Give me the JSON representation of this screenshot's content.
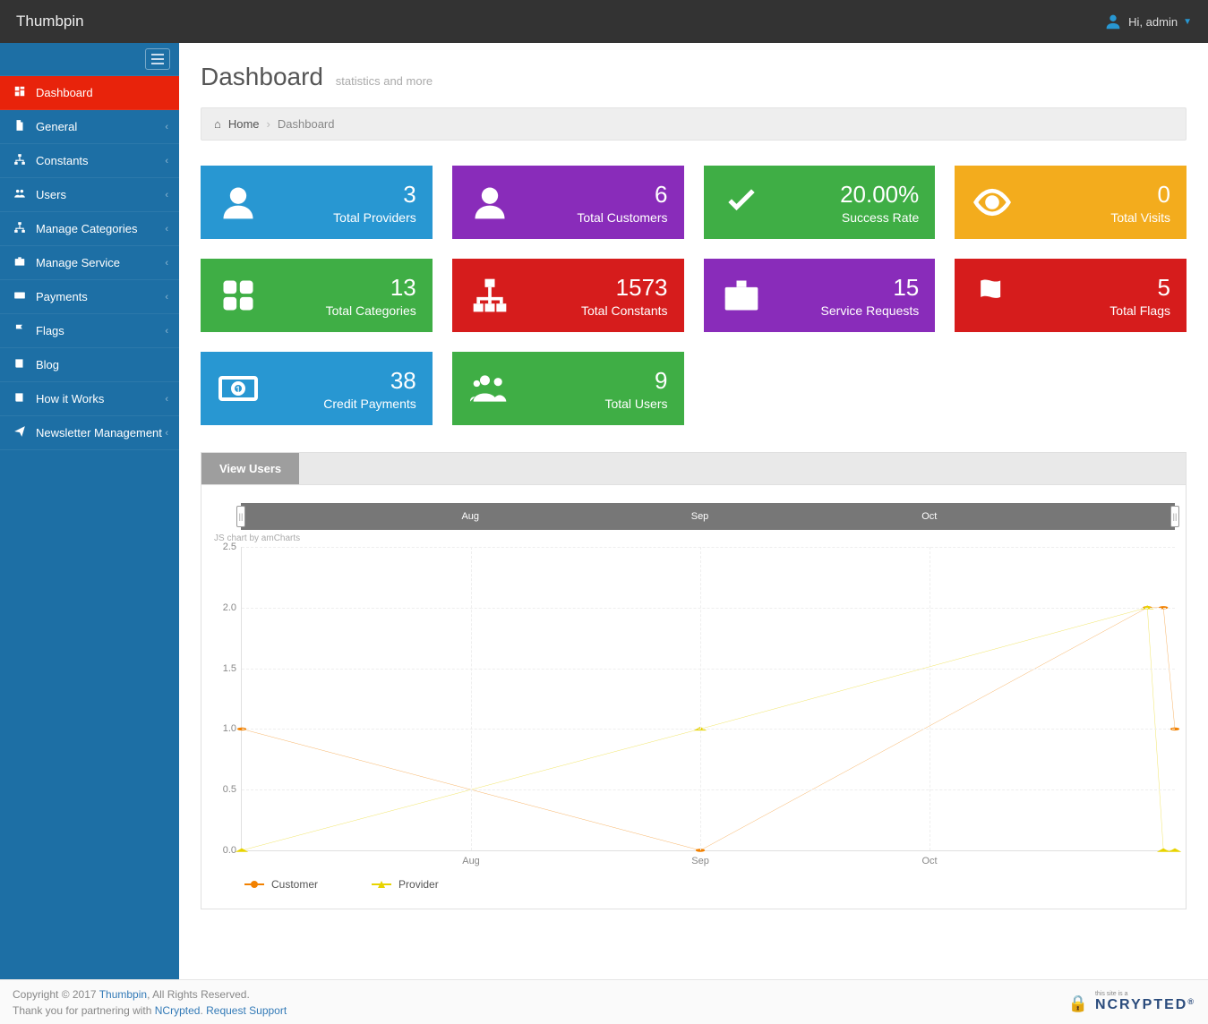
{
  "brand": "Thumbpin",
  "user_greeting": "Hi, admin",
  "page": {
    "title": "Dashboard",
    "subtitle": "statistics and more"
  },
  "breadcrumb": {
    "home": "Home",
    "current": "Dashboard"
  },
  "sidebar": [
    {
      "icon": "dashboard",
      "label": "Dashboard",
      "active": true,
      "expandable": false
    },
    {
      "icon": "file",
      "label": "General",
      "expandable": true
    },
    {
      "icon": "sitemap",
      "label": "Constants",
      "expandable": true
    },
    {
      "icon": "users",
      "label": "Users",
      "expandable": true
    },
    {
      "icon": "sitemap",
      "label": "Manage Categories",
      "expandable": true
    },
    {
      "icon": "briefcase",
      "label": "Manage Service",
      "expandable": true
    },
    {
      "icon": "money",
      "label": "Payments",
      "expandable": true
    },
    {
      "icon": "flag",
      "label": "Flags",
      "expandable": true
    },
    {
      "icon": "book",
      "label": "Blog",
      "expandable": false
    },
    {
      "icon": "book",
      "label": "How it Works",
      "expandable": true
    },
    {
      "icon": "send",
      "label": "Newsletter Management",
      "expandable": true
    }
  ],
  "cards": [
    {
      "icon": "user",
      "value": "3",
      "label": "Total Providers",
      "color": "blue"
    },
    {
      "icon": "user",
      "value": "6",
      "label": "Total Customers",
      "color": "purple"
    },
    {
      "icon": "check",
      "value": "20.00%",
      "label": "Success Rate",
      "color": "green"
    },
    {
      "icon": "eye",
      "value": "0",
      "label": "Total Visits",
      "color": "amber"
    },
    {
      "icon": "grid",
      "value": "13",
      "label": "Total Categories",
      "color": "green"
    },
    {
      "icon": "sitemap",
      "value": "1573",
      "label": "Total Constants",
      "color": "red"
    },
    {
      "icon": "briefcase",
      "value": "15",
      "label": "Service Requests",
      "color": "purple"
    },
    {
      "icon": "flag",
      "value": "5",
      "label": "Total Flags",
      "color": "red"
    },
    {
      "icon": "money",
      "value": "38",
      "label": "Credit Payments",
      "color": "blue"
    },
    {
      "icon": "users",
      "value": "9",
      "label": "Total Users",
      "color": "green"
    }
  ],
  "tabs": {
    "view_users": "View Users"
  },
  "chart_credit": "JS chart by amCharts",
  "chart_data": {
    "type": "line",
    "xlabels_slider": [
      "Aug",
      "Sep",
      "Oct"
    ],
    "xlabels": [
      "Aug",
      "Sep",
      "Oct"
    ],
    "ylim": [
      0.0,
      2.5
    ],
    "yticks": [
      0.0,
      0.5,
      1.0,
      1.5,
      2.0,
      2.5
    ],
    "x": [
      0,
      1,
      2,
      3,
      3.95,
      4.02,
      4.07
    ],
    "series": [
      {
        "name": "Customer",
        "color": "#f28100",
        "shape": "circle",
        "values": [
          1,
          null,
          0,
          null,
          2,
          2,
          1
        ]
      },
      {
        "name": "Provider",
        "color": "#e8d400",
        "shape": "triangle",
        "values": [
          0,
          null,
          1,
          null,
          2,
          0,
          0
        ]
      }
    ]
  },
  "footer": {
    "line1_a": "Copyright © 2017 ",
    "line1_b": "Thumbpin",
    "line1_c": ", All Rights Reserved.",
    "line2_a": "Thank you for partnering with ",
    "line2_b": "NCrypted",
    "line2_c": ". ",
    "line2_d": "Request Support",
    "ncrypted_small": "this site is a",
    "ncrypted_brand": "NCRYPTED"
  }
}
